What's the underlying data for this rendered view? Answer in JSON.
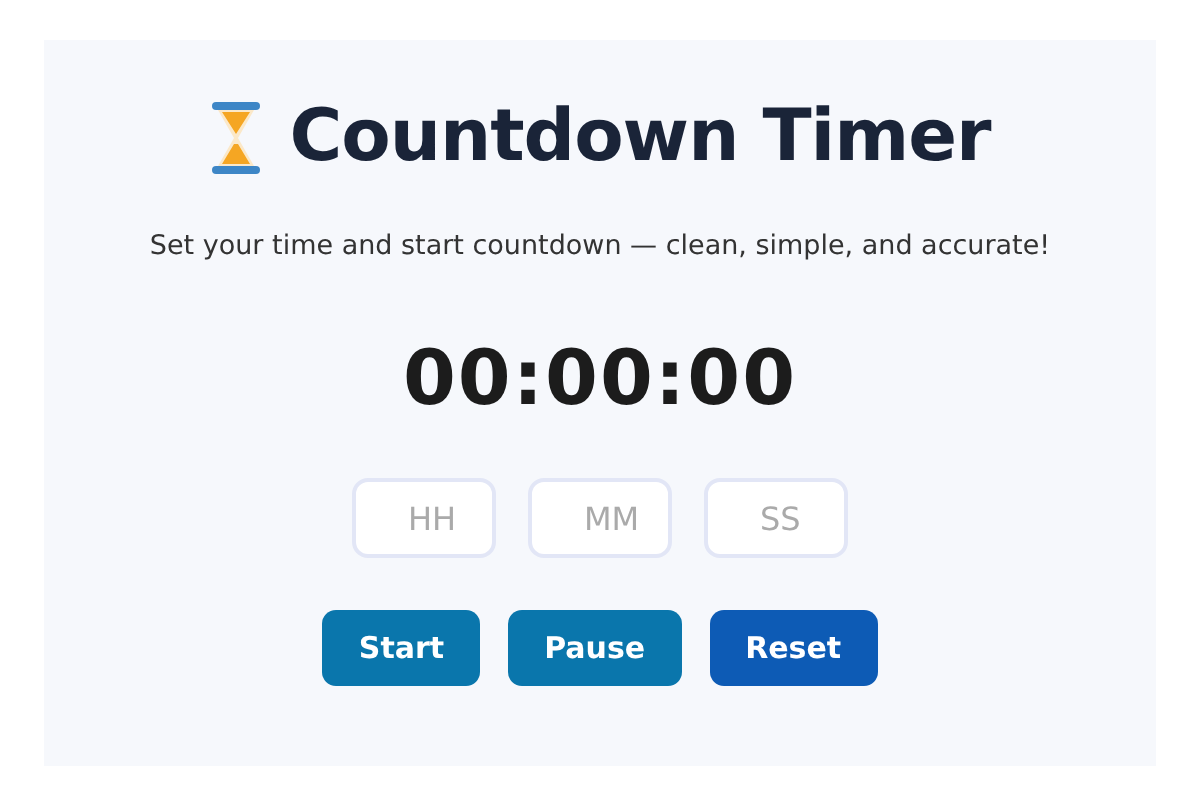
{
  "title": "Countdown Timer",
  "subtitle": "Set your time and start countdown — clean, simple, and accurate!",
  "display": "00:00:00",
  "fields": [
    {
      "placeholder": "HH"
    },
    {
      "placeholder": "MM"
    },
    {
      "placeholder": "SS"
    }
  ],
  "buttons": [
    {
      "label": "Start",
      "kind": "secondary"
    },
    {
      "label": "Pause",
      "kind": "secondary"
    },
    {
      "label": "Reset",
      "kind": "primary"
    }
  ]
}
